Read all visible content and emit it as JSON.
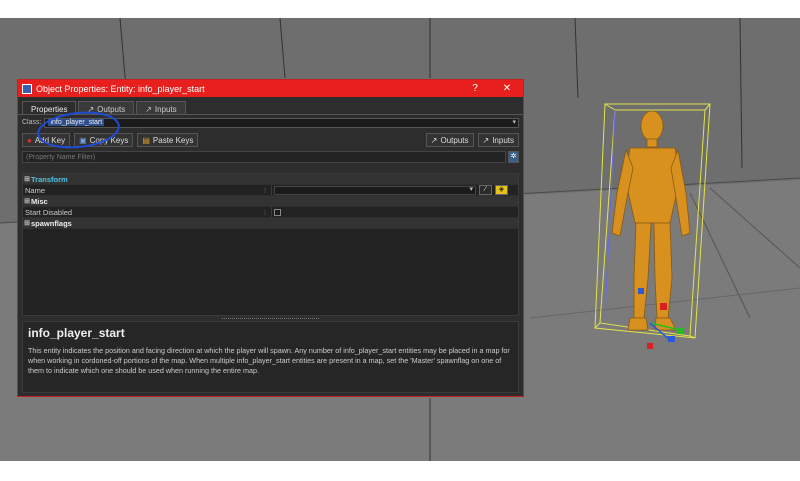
{
  "window": {
    "title": "Object Properties: Entity: info_player_start",
    "help_btn": "?",
    "close_btn": "✕"
  },
  "tabs": [
    {
      "label": "Properties",
      "icon": ""
    },
    {
      "label": "Outputs",
      "icon": "arrow-out-icon"
    },
    {
      "label": "Inputs",
      "icon": "arrow-in-icon"
    }
  ],
  "class_row": {
    "label": "Class:",
    "value": "info_player_start"
  },
  "toolbar": {
    "add_key": "Add Key",
    "copy_keys": "Copy Keys",
    "paste_keys": "Paste Keys",
    "outputs": "Outputs",
    "inputs": "Inputs"
  },
  "filter": {
    "placeholder": "(Property Name Filter)"
  },
  "grid": {
    "transform": "Transform",
    "name_label": "Name",
    "misc": "Misc",
    "start_disabled": "Start Disabled",
    "spawnflags": "spawnflags",
    "expander": "⊞"
  },
  "help": {
    "title": "info_player_start",
    "description": "This entity indicates the position and facing direction at which the player will spawn. Any number of info_player_start entities may be placed in a map for when working in cordoned-off portions of the map. When multiple info_player_start entities are present in a map, set the 'Master' spawnflag on one of them to indicate which one should be used when running the entire map."
  },
  "colors": {
    "titlebar": "#e8201d",
    "accent": "#4fc3e0",
    "annotation": "#1e4bd8"
  }
}
